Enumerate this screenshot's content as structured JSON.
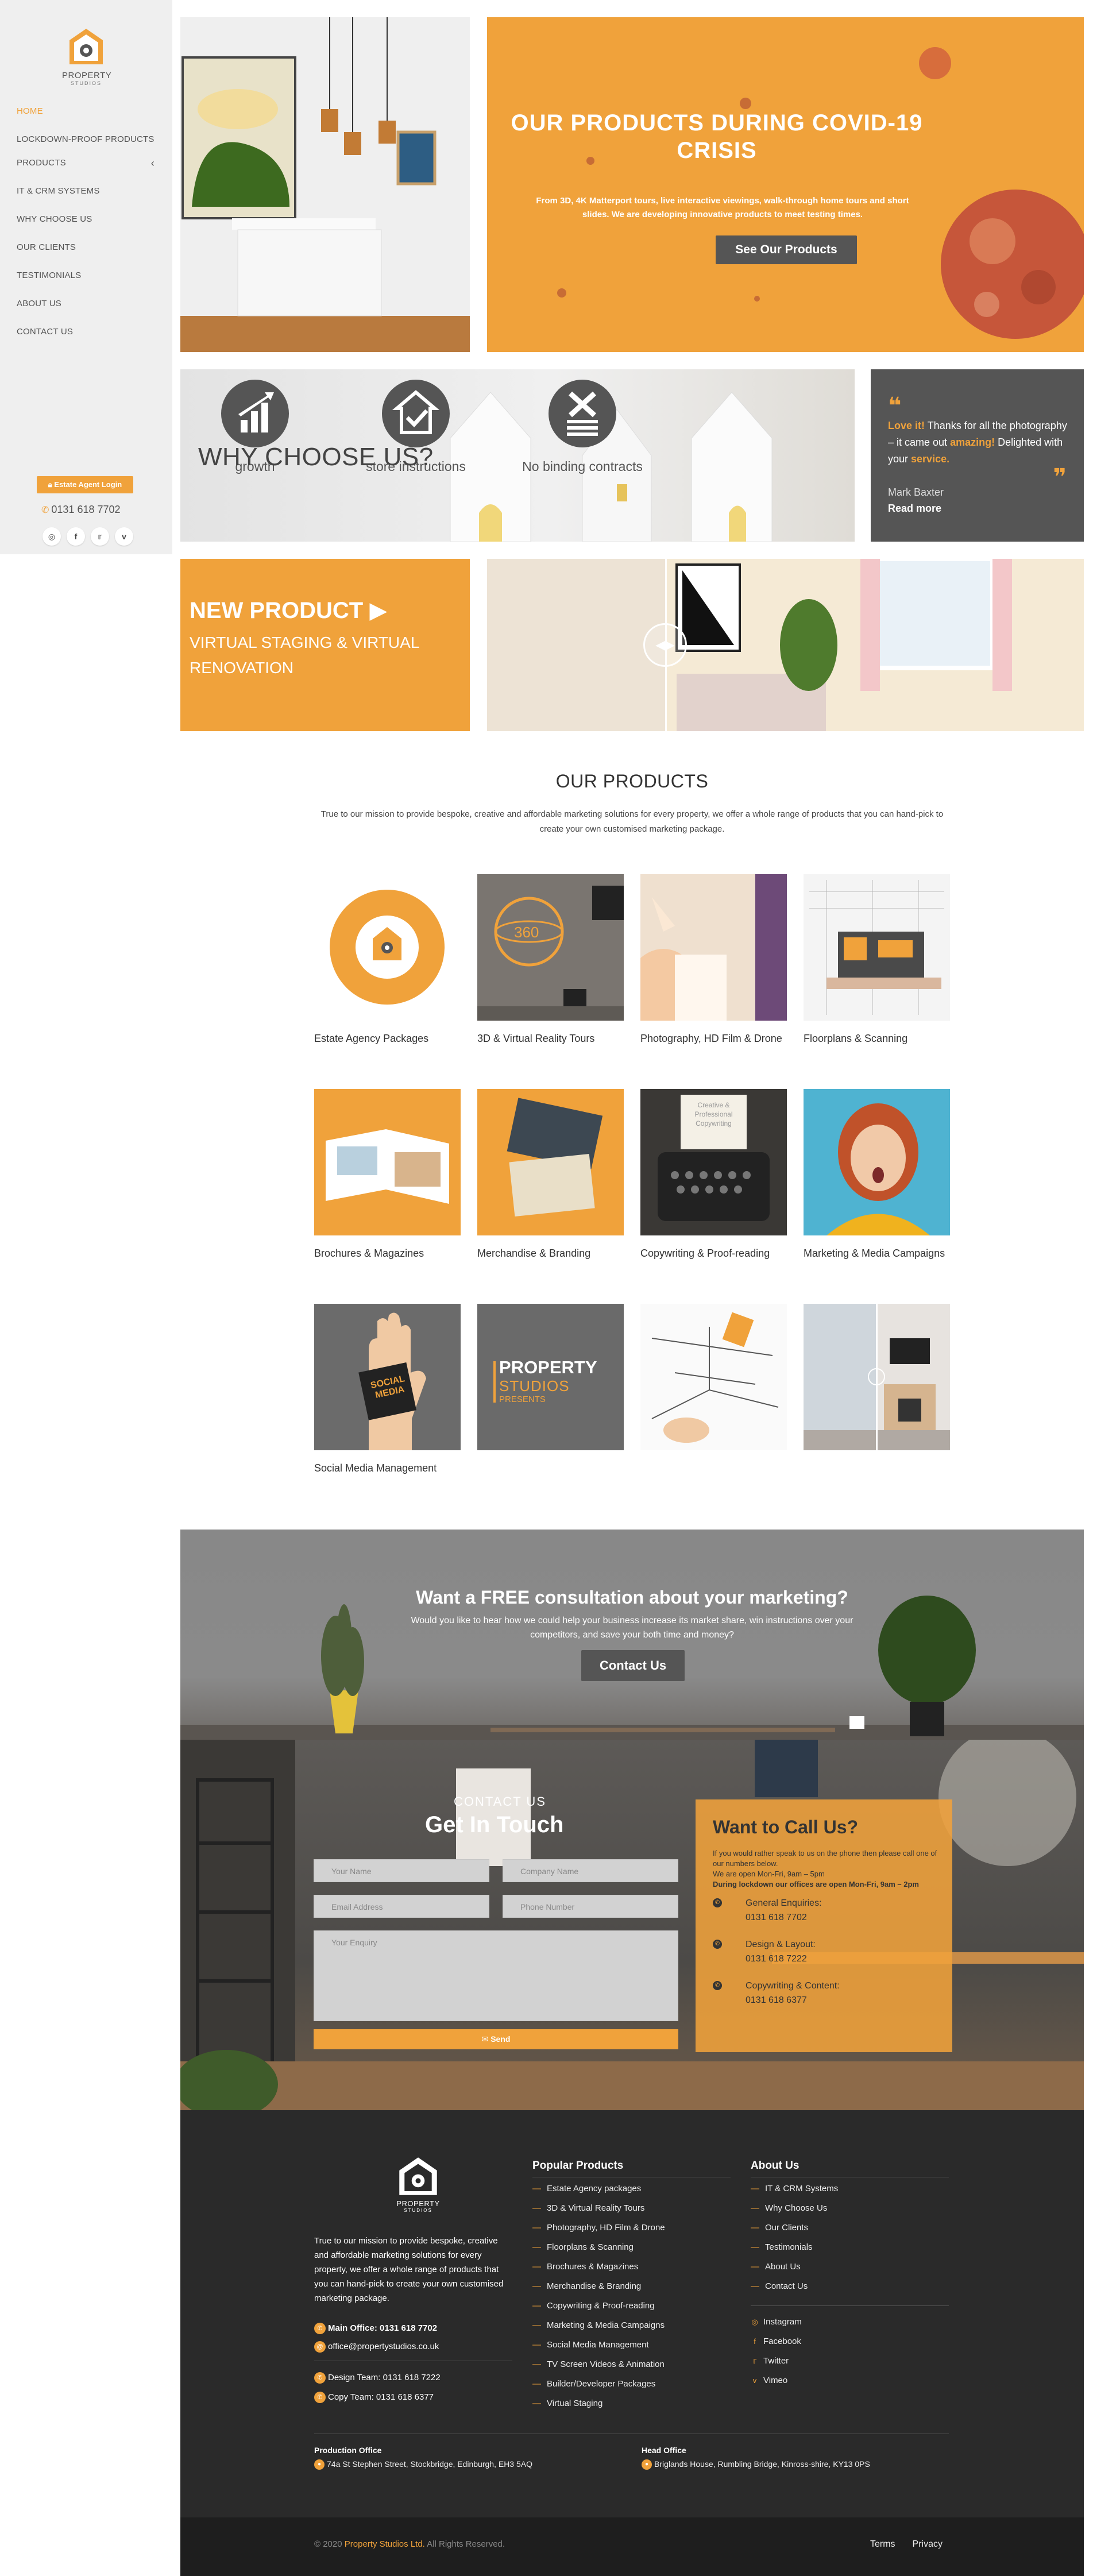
{
  "brand": {
    "name": "PROPERTY",
    "sub": "STUDIOS",
    "accent": "#f0a23b",
    "dark": "#555555"
  },
  "sidebar": {
    "items": [
      {
        "label": "HOME"
      },
      {
        "label": "LOCKDOWN-PROOF PRODUCTS"
      },
      {
        "label": "PRODUCTS"
      },
      {
        "label": "IT & CRM SYSTEMS"
      },
      {
        "label": "WHY CHOOSE US"
      },
      {
        "label": "OUR CLIENTS"
      },
      {
        "label": "TESTIMONIALS"
      },
      {
        "label": "ABOUT US"
      },
      {
        "label": "CONTACT US"
      }
    ],
    "agent_login": "Estate Agent Login",
    "phone": "0131 618 7702",
    "socials": [
      "instagram-icon",
      "facebook-icon",
      "twitter-icon",
      "vimeo-icon"
    ]
  },
  "hero": {
    "title": "OUR PRODUCTS DURING COVID-19 CRISIS",
    "text": "From 3D, 4K Matterport tours, live interactive viewings, walk-through home tours and short slides. We are developing innovative products to meet testing times.",
    "button": "See Our Products"
  },
  "why": {
    "title": "WHY CHOOSE US?",
    "items": [
      {
        "icon": "growth-chart-icon",
        "label": "growth"
      },
      {
        "icon": "house-check-icon",
        "label": "store instructions"
      },
      {
        "icon": "no-contract-icon",
        "label": "No binding contracts"
      }
    ]
  },
  "testimonial": {
    "lead": "Love it!",
    "text1": " Thanks for all the photography – it came out ",
    "emph": "amazing!",
    "text2": " Delighted with your ",
    "emph2": "service.",
    "author": "Mark Baxter",
    "more": "Read more"
  },
  "new_product": {
    "title": "NEW PRODUCT",
    "subtitle": "VIRTUAL STAGING & VIRTUAL RENOVATION"
  },
  "products": {
    "title": "OUR PRODUCTS",
    "intro": "True to our mission to provide bespoke, creative and affordable marketing solutions for every property, we offer a whole range of products that you can hand-pick to create your own customised marketing package.",
    "items": [
      {
        "label": "Estate Agency Packages"
      },
      {
        "label": "3D & Virtual Reality Tours"
      },
      {
        "label": "Photography, HD Film & Drone"
      },
      {
        "label": "Floorplans & Scanning"
      },
      {
        "label": "Brochures & Magazines"
      },
      {
        "label": "Merchandise & Branding"
      },
      {
        "label": "Copywriting & Proof-reading"
      },
      {
        "label": "Marketing & Media Campaigns"
      },
      {
        "label": "Social Media Management"
      },
      {
        "label": ""
      },
      {
        "label": ""
      },
      {
        "label": ""
      }
    ],
    "card_text": {
      "tour_360": "360",
      "typewriter": "Creative & Professional Copywriting",
      "social": "SOCIAL MEDIA",
      "presents_1": "PROPERTY",
      "presents_2": "STUDIOS",
      "presents_3": "PRESENTS"
    }
  },
  "consult": {
    "title": "Want a FREE consultation about your marketing?",
    "text": "Would you like to hear how we could help your business increase its market share, win instructions over your competitors, and save your both time and money?",
    "button": "Contact Us"
  },
  "contact": {
    "kicker": "CONTACT US",
    "title": "Get In Touch",
    "placeholders": {
      "name": "Your Name",
      "company": "Company Name",
      "email": "Email Address",
      "phone": "Phone Number",
      "enquiry": "Your Enquiry"
    },
    "send": "Send",
    "call": {
      "title": "Want to Call Us?",
      "text1": "If you would rather speak to us on the phone then please call one of our numbers below.",
      "text2": "We are open Mon-Fri, 9am – 5pm",
      "text3": "During lockdown our offices are open Mon-Fri, 9am – 2pm",
      "rows": [
        {
          "label": "General Enquiries:",
          "number": "0131 618 7702"
        },
        {
          "label": "Design & Layout:",
          "number": "0131 618 7222"
        },
        {
          "label": "Copywriting & Content:",
          "number": "0131 618 6377"
        }
      ]
    }
  },
  "footer": {
    "about": "True to our mission to provide bespoke, creative and affordable marketing solutions for every property, we offer a whole range of products that you can hand-pick to create your own customised marketing package.",
    "main_office_label": "Main Office:",
    "main_office": "0131 618 7702",
    "email": "office@propertystudios.co.uk",
    "design_team": "Design Team: 0131 618 7222",
    "copy_team": "Copy Team: 0131 618 6377",
    "popular_title": "Popular Products",
    "popular": [
      "Estate Agency packages",
      "3D & Virtual Reality Tours",
      "Photography, HD Film & Drone",
      "Floorplans & Scanning",
      "Brochures & Magazines",
      "Merchandise & Branding",
      "Copywriting & Proof-reading",
      "Marketing & Media Campaigns",
      "Social Media Management",
      "TV Screen Videos & Animation",
      "Builder/Developer Packages",
      "Virtual Staging"
    ],
    "about_title": "About Us",
    "about_links": [
      "IT & CRM Systems",
      "Why Choose Us",
      "Our Clients",
      "Testimonials",
      "About Us",
      "Contact Us"
    ],
    "social_links": [
      "Instagram",
      "Facebook",
      "Twitter",
      "Vimeo"
    ],
    "production_title": "Production Office",
    "production_addr": "74a St Stephen Street, Stockbridge, Edinburgh, EH3 5AQ",
    "head_title": "Head Office",
    "head_addr": "Briglands House, Rumbling Bridge, Kinross-shire, KY13 0PS",
    "copy_prefix": "© 2020 ",
    "copy_company": "Property Studios Ltd.",
    "copy_suffix": " All Rights Reserved.",
    "terms": "Terms",
    "privacy": "Privacy"
  }
}
